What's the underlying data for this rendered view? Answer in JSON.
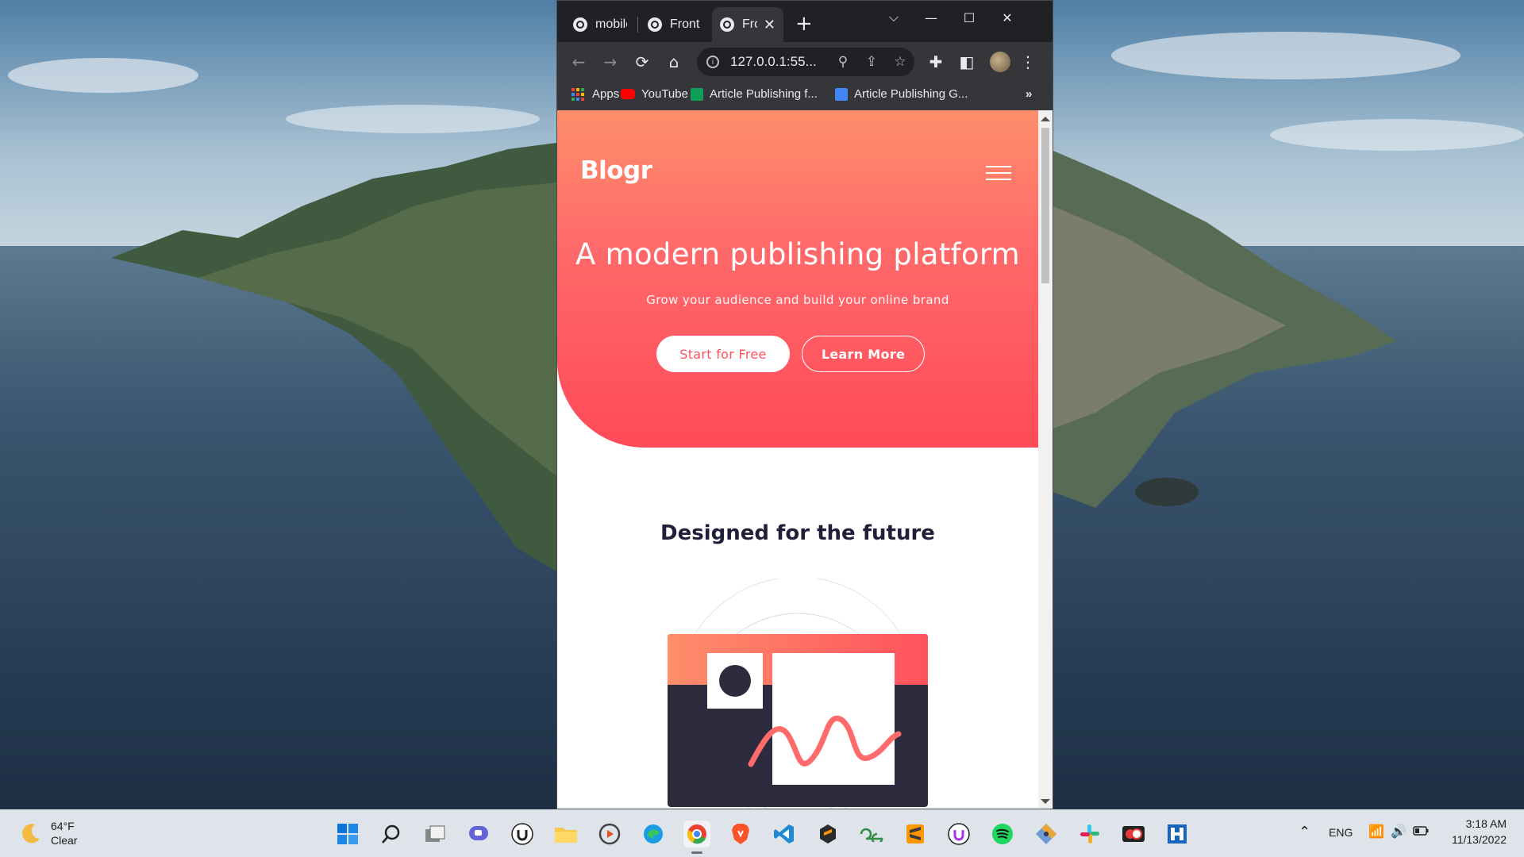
{
  "browser": {
    "tabs": [
      {
        "title": "mobile"
      },
      {
        "title": "Fronte"
      },
      {
        "title": "Fro",
        "active": true
      }
    ],
    "address": "127.0.0.1:55...",
    "bookmarks": [
      {
        "label": "Apps"
      },
      {
        "label": "YouTube"
      },
      {
        "label": "Article Publishing f..."
      },
      {
        "label": "Article Publishing G..."
      }
    ],
    "bookmarks_more": "»"
  },
  "page": {
    "logo": "Blogr",
    "hero_title": "A modern publishing platform",
    "hero_subtitle": "Grow your audience and build your online brand",
    "btn_start": "Start for Free",
    "btn_learn": "Learn More",
    "section_title": "Designed for the future",
    "colors": {
      "hero_top": "#ff8e6b",
      "hero_bottom": "#ff4a5a",
      "dark": "#2c2c3e",
      "text_dark": "#1f1f3a"
    }
  },
  "taskbar": {
    "weather_temp": "64°F",
    "weather_desc": "Clear",
    "language": "ENG",
    "time": "3:18 AM",
    "date": "11/13/2022",
    "apps": [
      "start-icon",
      "search-icon",
      "task-view-icon",
      "chat-icon",
      "udemy-icon",
      "file-explorer-icon",
      "media-player-icon",
      "edge-icon",
      "chrome-icon",
      "brave-icon",
      "vscode-icon",
      "sublime-merge-icon",
      "geeksforgeeks-icon",
      "sublime-text-icon",
      "udemy-icon",
      "spotify-icon",
      "git-icon",
      "slack-icon",
      "todo-icon",
      "h-app-icon"
    ]
  }
}
